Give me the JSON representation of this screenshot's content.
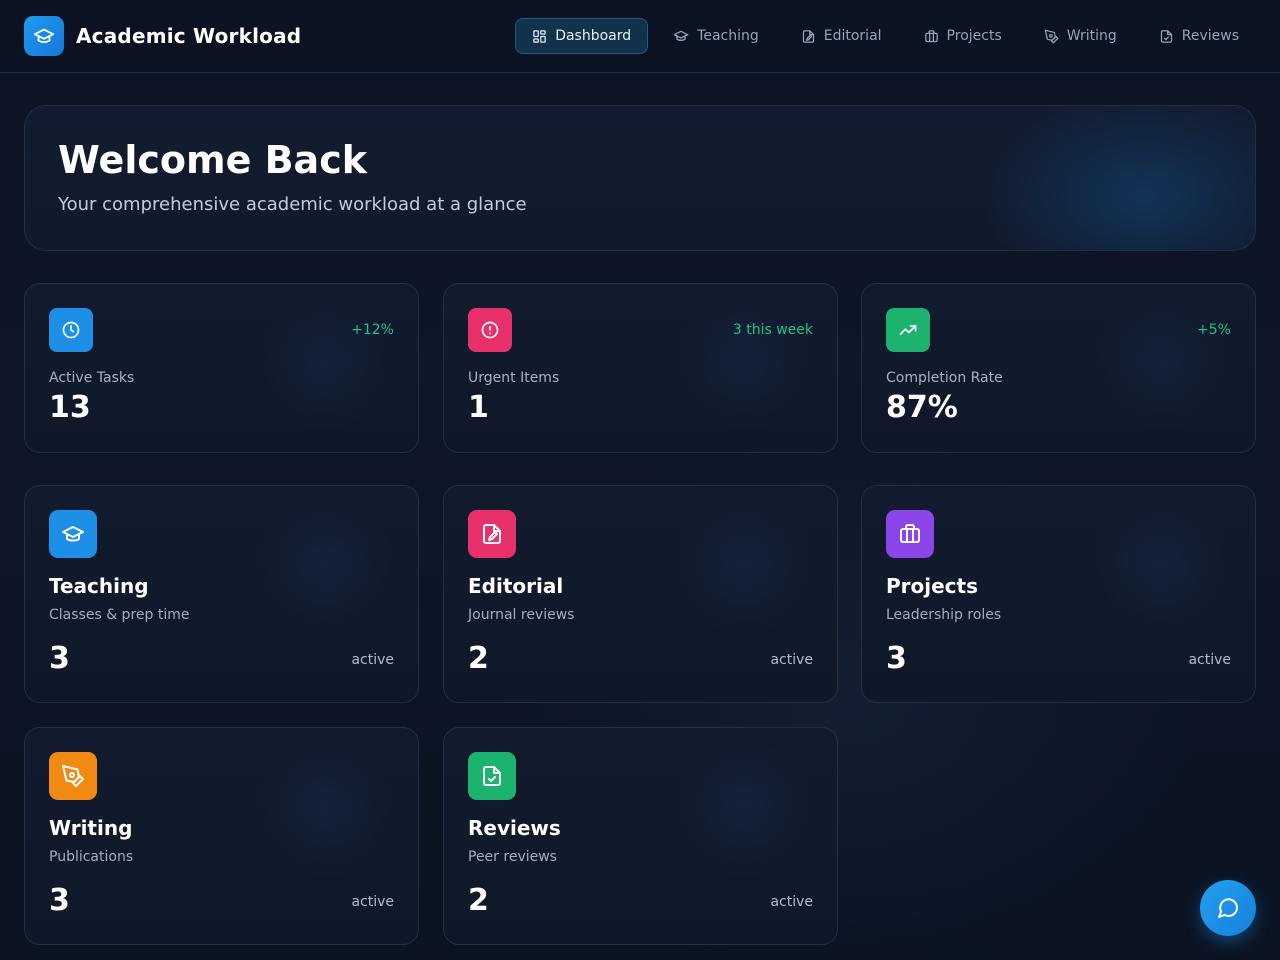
{
  "app": {
    "title": "Academic Workload"
  },
  "nav": {
    "items": [
      {
        "label": "Dashboard",
        "icon": "grid-icon",
        "active": true
      },
      {
        "label": "Teaching",
        "icon": "graduation-cap-icon",
        "active": false
      },
      {
        "label": "Editorial",
        "icon": "file-pen-icon",
        "active": false
      },
      {
        "label": "Projects",
        "icon": "briefcase-icon",
        "active": false
      },
      {
        "label": "Writing",
        "icon": "pen-tool-icon",
        "active": false
      },
      {
        "label": "Reviews",
        "icon": "file-check-icon",
        "active": false
      }
    ]
  },
  "hero": {
    "title": "Welcome Back",
    "subtitle": "Your comprehensive academic workload at a glance"
  },
  "stats": [
    {
      "label": "Active Tasks",
      "value": "13",
      "change": "+12%",
      "icon": "clock-icon",
      "color": "#1e8fe6"
    },
    {
      "label": "Urgent Items",
      "value": "1",
      "change": "3 this week",
      "icon": "alert-circle-icon",
      "color": "#e8306a"
    },
    {
      "label": "Completion Rate",
      "value": "87%",
      "change": "+5%",
      "icon": "trending-up-icon",
      "color": "#1cb36f"
    }
  ],
  "categories": [
    {
      "title": "Teaching",
      "subtitle": "Classes & prep time",
      "count": "3",
      "status": "active",
      "icon": "graduation-cap-icon",
      "color": "#1e8fe6"
    },
    {
      "title": "Editorial",
      "subtitle": "Journal reviews",
      "count": "2",
      "status": "active",
      "icon": "file-pen-icon",
      "color": "#e8306a"
    },
    {
      "title": "Projects",
      "subtitle": "Leadership roles",
      "count": "3",
      "status": "active",
      "icon": "briefcase-icon",
      "color": "#8b45e8"
    },
    {
      "title": "Writing",
      "subtitle": "Publications",
      "count": "3",
      "status": "active",
      "icon": "pen-tool-icon",
      "color": "#f08a12"
    },
    {
      "title": "Reviews",
      "subtitle": "Peer reviews",
      "count": "2",
      "status": "active",
      "icon": "file-check-icon",
      "color": "#1cb36f"
    }
  ],
  "chat": {
    "icon": "message-circle-icon"
  },
  "colors": {
    "accent": "#1e8fe6",
    "positive": "#22c08a",
    "background": "#0d1527"
  }
}
